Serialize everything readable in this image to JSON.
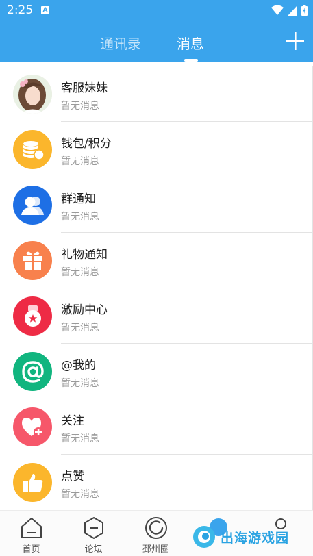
{
  "status_bar": {
    "time": "2:25",
    "notification_icon": "A"
  },
  "header": {
    "tabs": [
      {
        "label": "通讯录",
        "active": false
      },
      {
        "label": "消息",
        "active": true
      }
    ],
    "add_icon": "plus-icon",
    "accent_color": "#3aa4ec"
  },
  "messages": [
    {
      "title": "客服妹妹",
      "subtitle": "暂无消息",
      "icon": "avatar-photo",
      "color": "#f3dfe3"
    },
    {
      "title": "钱包/积分",
      "subtitle": "暂无消息",
      "icon": "coins-icon",
      "color": "#fbb62c"
    },
    {
      "title": "群通知",
      "subtitle": "暂无消息",
      "icon": "group-icon",
      "color": "#1e6fe5"
    },
    {
      "title": "礼物通知",
      "subtitle": "暂无消息",
      "icon": "gift-icon",
      "color": "#f8814d"
    },
    {
      "title": "激励中心",
      "subtitle": "暂无消息",
      "icon": "medal-icon",
      "color": "#ee2b45"
    },
    {
      "title": "@我的",
      "subtitle": "暂无消息",
      "icon": "at-icon",
      "color": "#11b57f"
    },
    {
      "title": "关注",
      "subtitle": "暂无消息",
      "icon": "heart-plus-icon",
      "color": "#f6576a"
    },
    {
      "title": "点赞",
      "subtitle": "暂无消息",
      "icon": "thumbs-up-icon",
      "color": "#fbb62c"
    }
  ],
  "bottom_nav": [
    {
      "label": "首页",
      "icon": "home-icon"
    },
    {
      "label": "论坛",
      "icon": "forum-icon"
    },
    {
      "label": "邳州圈",
      "icon": "circle-icon"
    },
    {
      "label": "",
      "icon": "message-icon"
    },
    {
      "label": "",
      "icon": "profile-icon"
    }
  ],
  "watermark": {
    "text": "出海游戏园"
  }
}
